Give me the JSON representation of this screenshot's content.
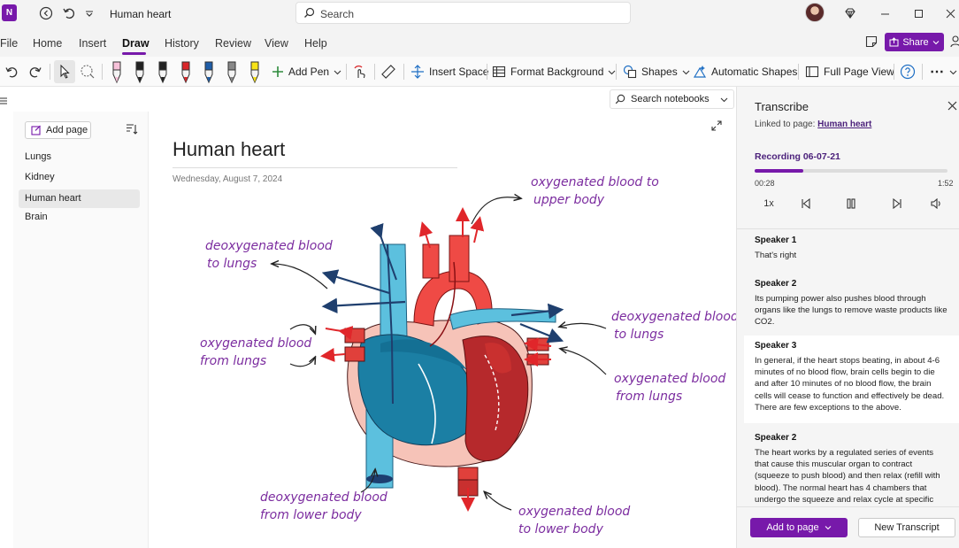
{
  "window": {
    "app_icon_text": "N",
    "title": "Human heart",
    "search_placeholder": "Search"
  },
  "menu": {
    "items": [
      "File",
      "Home",
      "Insert",
      "Draw",
      "History",
      "Review",
      "View",
      "Help"
    ],
    "active": "Draw",
    "share_label": "Share"
  },
  "toolbar": {
    "add_pen": "Add Pen",
    "insert_space": "Insert Space",
    "format_background": "Format Background",
    "shapes": "Shapes",
    "automatic_shapes": "Automatic Shapes",
    "full_page_view": "Full Page View",
    "pen_colors": [
      "#f7c1d9",
      "#222222",
      "#222222",
      "#d9262a",
      "#1f5ea8",
      "#888888",
      "#f7e318"
    ]
  },
  "sidebar": {
    "add_page_label": "Add page",
    "pages": [
      "Lungs",
      "Kidney",
      "Human heart",
      "Brain"
    ],
    "selected_page": "Human heart"
  },
  "search_notebooks": {
    "label": "Search notebooks"
  },
  "page": {
    "title": "Human heart",
    "date": "Wednesday, August 7, 2024",
    "annotations": {
      "upper_body_1": "oxygenated blood to",
      "upper_body_2": "upper body",
      "deoxy_lungs_left_1": "deoxygenated blood",
      "deoxy_lungs_left_2": "to lungs",
      "oxy_from_lungs_left_1": "oxygenated blood",
      "oxy_from_lungs_left_2": "from lungs",
      "deoxy_lungs_right_1": "deoxygenated blood",
      "deoxy_lungs_right_2": "to lungs",
      "oxy_from_lungs_right_1": "oxygenated blood",
      "oxy_from_lungs_right_2": "from lungs",
      "deoxy_lower_1": "deoxygenated blood",
      "deoxy_lower_2": "from lower body",
      "oxy_lower_1": "oxygenated blood",
      "oxy_lower_2": "to lower body"
    }
  },
  "transcribe": {
    "title": "Transcribe",
    "linked_prefix": "Linked to page:",
    "linked_page": "Human heart",
    "recording_title": "Recording 06-07-21",
    "elapsed": "00:28",
    "duration": "1:52",
    "progress_fraction": 0.25,
    "speed": "1x",
    "utterances": [
      {
        "speaker": "Speaker 1",
        "text": "That's right"
      },
      {
        "speaker": "Speaker 2",
        "text": "Its pumping power also pushes blood through organs like the lungs to remove waste products like CO2."
      },
      {
        "speaker": "Speaker 3",
        "text": "In general, if the heart stops beating, in about 4-6 minutes of no blood flow, brain cells begin to die and after 10 minutes of no blood flow, the brain cells will cease to function and effectively be dead. There are few exceptions to the above."
      },
      {
        "speaker": "Speaker 2",
        "text": "The heart works by a regulated series of events that cause this muscular organ to contract (squeeze to push blood) and then relax (refill with blood). The normal heart has 4 chambers that undergo the squeeze and relax cycle at specific time intervals"
      }
    ],
    "add_to_page": "Add to page",
    "new_transcript": "New Transcript"
  },
  "colors": {
    "accent": "#7719aa",
    "deoxygenated": "#2a8fb6",
    "oxygenated": "#e8403a",
    "annotation_ink": "#7b2c9f"
  }
}
